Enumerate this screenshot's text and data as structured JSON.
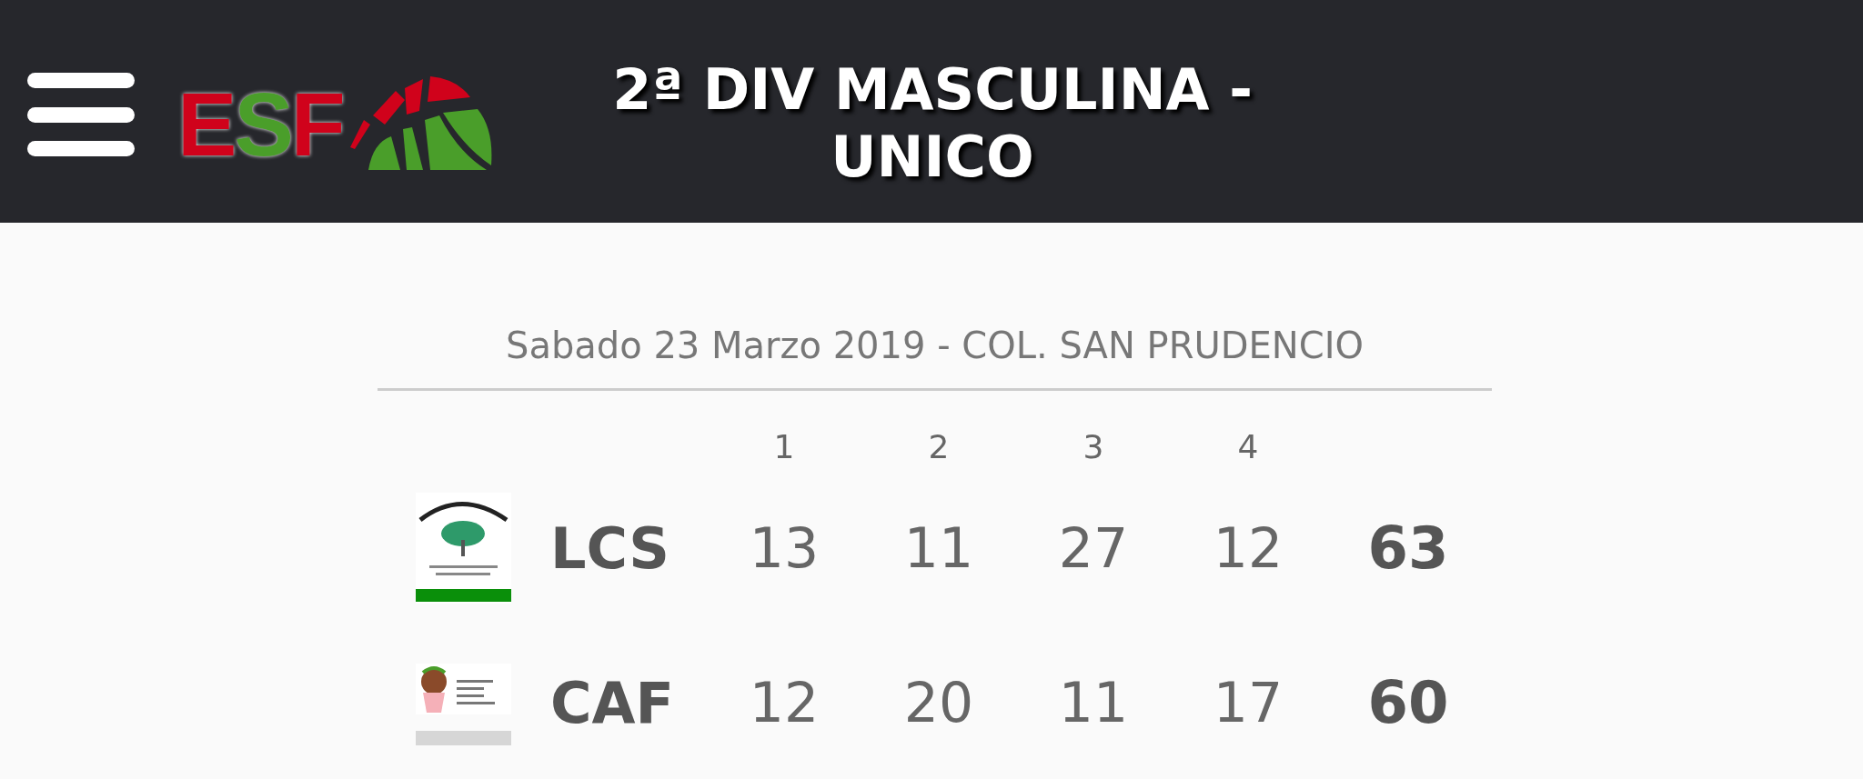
{
  "header": {
    "logo_letters": [
      {
        "letter": "E",
        "color": "#d0021b"
      },
      {
        "letter": "S",
        "color": "#4a9e2a"
      },
      {
        "letter": "F",
        "color": "#d0021b"
      }
    ],
    "title": "2ª DIV MASCULINA - UNICO"
  },
  "match": {
    "date_venue": "Sabado 23 Marzo 2019 - COL. SAN PRUDENCIO",
    "periods": [
      "1",
      "2",
      "3",
      "4"
    ],
    "teams": [
      {
        "name": "LCS",
        "kind": "tree",
        "scores": [
          "13",
          "11",
          "27",
          "12"
        ],
        "total": "63"
      },
      {
        "name": "CAF",
        "kind": "ball",
        "scores": [
          "12",
          "20",
          "11",
          "17"
        ],
        "total": "60"
      }
    ]
  }
}
